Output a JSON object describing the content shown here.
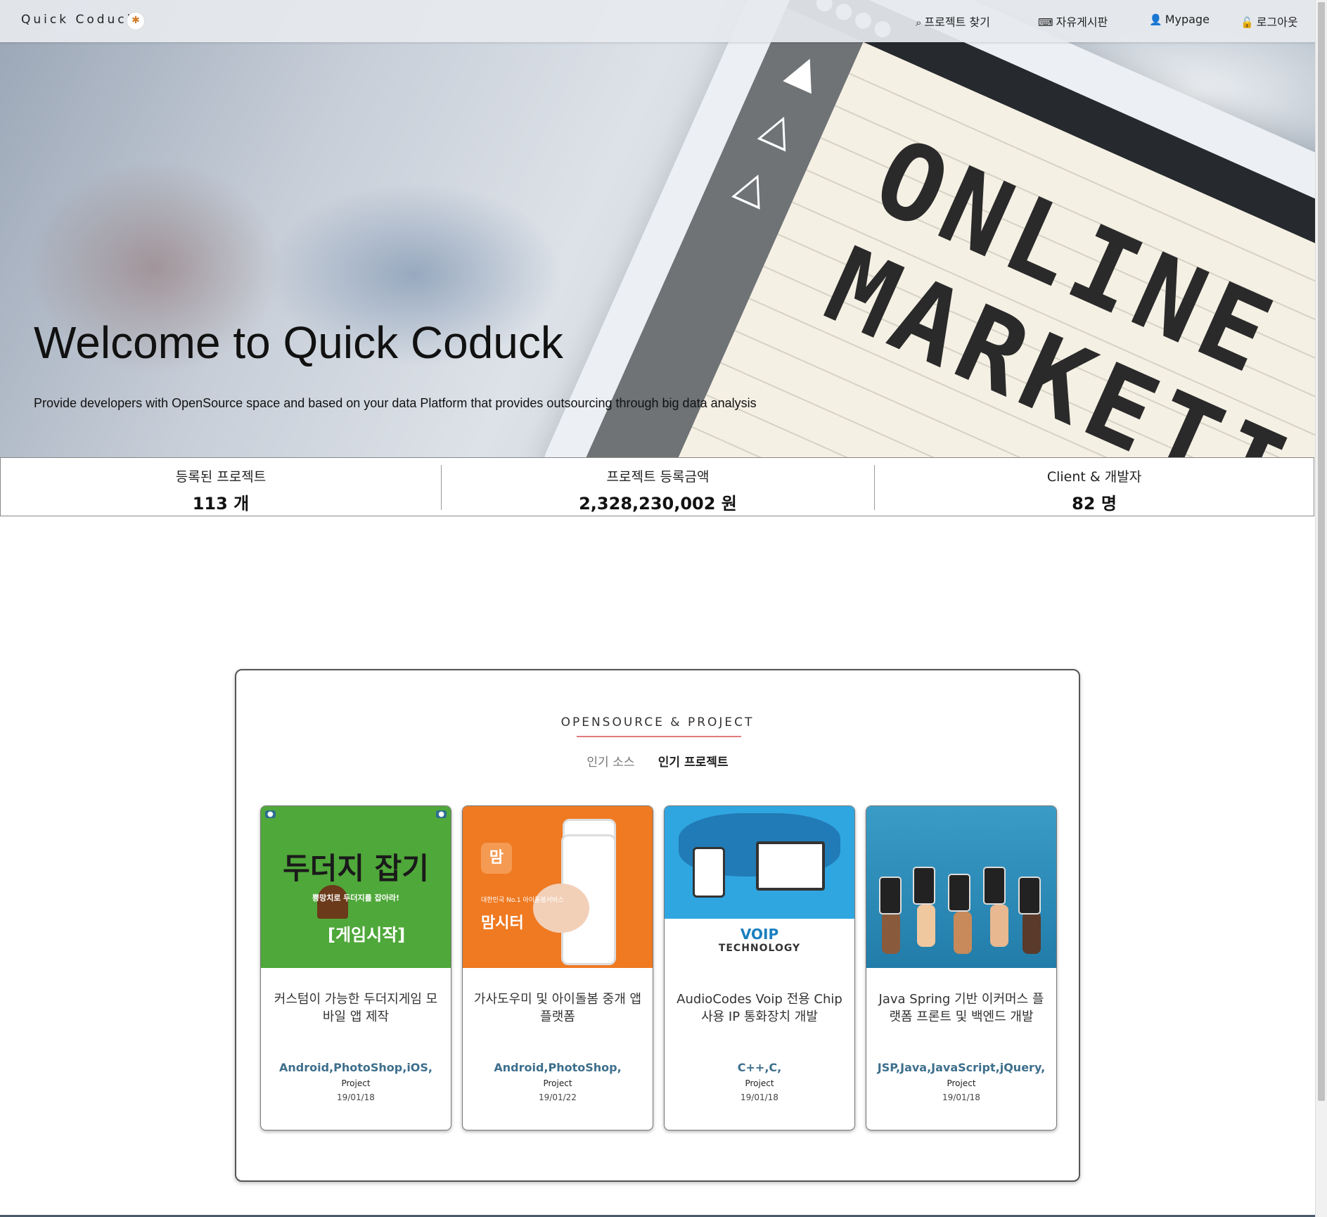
{
  "nav": {
    "brand": "Quick Coduck",
    "items": [
      {
        "icon": "search-icon",
        "label": "프로젝트 찾기"
      },
      {
        "icon": "keyboard-icon",
        "label": "자유게시판"
      },
      {
        "icon": "user-icon",
        "label": "Mypage"
      },
      {
        "icon": "lock-icon",
        "label": "로그아웃"
      }
    ]
  },
  "hero": {
    "title": "Welcome to Quick Coduck",
    "subtitle": "Provide developers with OpenSource space and based on your data Platform that provides outsourcing through big data analysis",
    "image_text": "ONLINE MARKETI"
  },
  "stats": [
    {
      "label": "등록된 프로젝트",
      "value": "113 개"
    },
    {
      "label": "프로젝트 등록금액",
      "value": "2,328,230,002 원"
    },
    {
      "label": "Client & 개발자",
      "value": "82 명"
    }
  ],
  "section": {
    "title": "OPENSOURCE & PROJECT",
    "tabs": [
      {
        "label": "인기 소스",
        "active": false
      },
      {
        "label": "인기 프로젝트",
        "active": true
      }
    ],
    "accent_color": "#e07a7a"
  },
  "cards": [
    {
      "title": "커스텀이 가능한 두더지게임 모바일 앱 제작",
      "tags": "Android,PhotoShop,iOS,",
      "type": "Project",
      "date": "19/01/18",
      "thumb": {
        "big": "두더지 잡기",
        "small": "뿅망치로 두더지를 잡아라!",
        "button": "[게임시작]"
      }
    },
    {
      "title": "가사도우미 및 아이돌봄 중개 앱 플랫폼",
      "tags": "Android,PhotoShop,",
      "type": "Project",
      "date": "19/01/22",
      "thumb": {
        "sub": "대한민국 No.1 아이돌봄서비스",
        "brand": "맘시터"
      }
    },
    {
      "title": "AudioCodes Voip 전용 Chip 사용 IP 통화장치 개발",
      "tags": "C++,C,",
      "type": "Project",
      "date": "19/01/18",
      "thumb": {
        "line1": "VOIP",
        "line2": "TECHNOLOGY"
      }
    },
    {
      "title": "Java Spring 기반 이커머스 플랫폼 프론트 및 백엔드 개발",
      "tags": "JSP,Java,JavaScript,jQuery,",
      "type": "Project",
      "date": "19/01/18",
      "thumb": {}
    }
  ]
}
